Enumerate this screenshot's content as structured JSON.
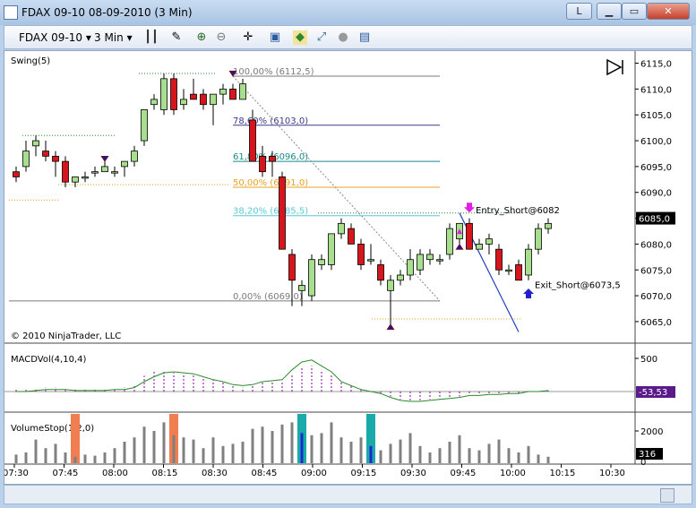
{
  "window": {
    "title": "FDAX 09-10  08-09-2010 (3 Min)",
    "lock_label": "L",
    "min_label": "▁",
    "max_label": "▭",
    "close_label": "✕"
  },
  "toolbar": {
    "instrument": "FDAX 09-10",
    "interval": "3 Min",
    "icons": [
      "bar-type-icon",
      "pencil-icon",
      "zoom-in-icon",
      "zoom-out-icon",
      "crosshair-icon",
      "data-box-icon",
      "strategy-icon",
      "chart-trader-icon",
      "properties-icon",
      "grid-icon"
    ]
  },
  "colors": {
    "up_candle": "#a8df8e",
    "down_candle": "#d6161c",
    "fib_base": "#7a7a7a",
    "fib_1": "#3a3a8a",
    "fib_2": "#1a8a8a",
    "fib_3": "#e8a020",
    "fib_4": "#5ac8d8",
    "entry_arrow": "#e020e0",
    "exit_arrow": "#2020d0",
    "macd_line": "#2a8a2a",
    "macd_hist": "#8a00a0",
    "volstop_orange": "#f07e50",
    "volstop_teal": "#1aaaaa",
    "volume_gray": "#808080"
  },
  "chart_data": {
    "type": "candlestick",
    "x_ticks": [
      "07:30",
      "07:45",
      "08:00",
      "08:15",
      "08:30",
      "08:45",
      "09:00",
      "09:15",
      "09:30",
      "09:45",
      "10:00",
      "10:15",
      "10:30"
    ],
    "candles": [
      {
        "o": 6094,
        "h": 6095,
        "l": 6092,
        "c": 6093
      },
      {
        "o": 6095,
        "h": 6100,
        "l": 6094,
        "c": 6098
      },
      {
        "o": 6099,
        "h": 6101,
        "l": 6097,
        "c": 6100
      },
      {
        "o": 6098,
        "h": 6100,
        "l": 6096,
        "c": 6097
      },
      {
        "o": 6097,
        "h": 6098,
        "l": 6093,
        "c": 6096
      },
      {
        "o": 6096,
        "h": 6097,
        "l": 6091,
        "c": 6092
      },
      {
        "o": 6092,
        "h": 6093,
        "l": 6091,
        "c": 6093
      },
      {
        "o": 6093,
        "h": 6094,
        "l": 6092,
        "c": 6093
      },
      {
        "o": 6094,
        "h": 6095,
        "l": 6093,
        "c": 6094
      },
      {
        "o": 6094,
        "h": 6096,
        "l": 6094,
        "c": 6095
      },
      {
        "o": 6094,
        "h": 6095,
        "l": 6093,
        "c": 6094
      },
      {
        "o": 6095,
        "h": 6096,
        "l": 6093,
        "c": 6096
      },
      {
        "o": 6096,
        "h": 6099,
        "l": 6095,
        "c": 6098
      },
      {
        "o": 6100,
        "h": 6106,
        "l": 6099,
        "c": 6106
      },
      {
        "o": 6107,
        "h": 6109,
        "l": 6106,
        "c": 6108
      },
      {
        "o": 6106,
        "h": 6113,
        "l": 6105,
        "c": 6112
      },
      {
        "o": 6112,
        "h": 6113,
        "l": 6105,
        "c": 6106
      },
      {
        "o": 6107,
        "h": 6110,
        "l": 6106,
        "c": 6108
      },
      {
        "o": 6109,
        "h": 6112,
        "l": 6108,
        "c": 6108
      },
      {
        "o": 6109,
        "h": 6110,
        "l": 6106,
        "c": 6107
      },
      {
        "o": 6107,
        "h": 6109,
        "l": 6103,
        "c": 6109
      },
      {
        "o": 6109,
        "h": 6111,
        "l": 6107,
        "c": 6110
      },
      {
        "o": 6110,
        "h": 6111,
        "l": 6108,
        "c": 6108
      },
      {
        "o": 6108,
        "h": 6112,
        "l": 6108,
        "c": 6111
      },
      {
        "o": 6104,
        "h": 6106,
        "l": 6096,
        "c": 6096
      },
      {
        "o": 6097,
        "h": 6099,
        "l": 6093,
        "c": 6094
      },
      {
        "o": 6097,
        "h": 6098,
        "l": 6093,
        "c": 6096
      },
      {
        "o": 6093,
        "h": 6094,
        "l": 6079,
        "c": 6079
      },
      {
        "o": 6078,
        "h": 6079,
        "l": 6068,
        "c": 6073
      },
      {
        "o": 6071,
        "h": 6073,
        "l": 6068,
        "c": 6072
      },
      {
        "o": 6070,
        "h": 6078,
        "l": 6069,
        "c": 6077
      },
      {
        "o": 6076,
        "h": 6078,
        "l": 6075,
        "c": 6077
      },
      {
        "o": 6076,
        "h": 6082,
        "l": 6075,
        "c": 6082
      },
      {
        "o": 6082,
        "h": 6085,
        "l": 6081,
        "c": 6084
      },
      {
        "o": 6083,
        "h": 6084,
        "l": 6080,
        "c": 6080
      },
      {
        "o": 6080,
        "h": 6081,
        "l": 6075,
        "c": 6076
      },
      {
        "o": 6077,
        "h": 6080,
        "l": 6076,
        "c": 6077
      },
      {
        "o": 6076,
        "h": 6077,
        "l": 6072,
        "c": 6073
      },
      {
        "o": 6071,
        "h": 6074,
        "l": 6064,
        "c": 6073
      },
      {
        "o": 6073,
        "h": 6075,
        "l": 6072,
        "c": 6074
      },
      {
        "o": 6074,
        "h": 6079,
        "l": 6073,
        "c": 6077
      },
      {
        "o": 6075,
        "h": 6079,
        "l": 6074,
        "c": 6078
      },
      {
        "o": 6077,
        "h": 6079,
        "l": 6076,
        "c": 6078
      },
      {
        "o": 6077,
        "h": 6078,
        "l": 6076,
        "c": 6077
      },
      {
        "o": 6078,
        "h": 6084,
        "l": 6077,
        "c": 6083
      },
      {
        "o": 6081,
        "h": 6084,
        "l": 6080,
        "c": 6084
      },
      {
        "o": 6084,
        "h": 6085,
        "l": 6079,
        "c": 6079
      },
      {
        "o": 6079,
        "h": 6081,
        "l": 6079,
        "c": 6080
      },
      {
        "o": 6080,
        "h": 6082,
        "l": 6078,
        "c": 6081
      },
      {
        "o": 6079,
        "h": 6080,
        "l": 6074,
        "c": 6075
      },
      {
        "o": 6075,
        "h": 6076,
        "l": 6074,
        "c": 6075
      },
      {
        "o": 6076,
        "h": 6077,
        "l": 6073,
        "c": 6073
      },
      {
        "o": 6074,
        "h": 6080,
        "l": 6073,
        "c": 6079
      },
      {
        "o": 6079,
        "h": 6084,
        "l": 6078,
        "c": 6083
      },
      {
        "o": 6083,
        "h": 6085,
        "l": 6082,
        "c": 6084
      }
    ],
    "price_axis": {
      "ylim": [
        6061,
        6117
      ],
      "ticks": [
        "6115,0",
        "6110,0",
        "6105,0",
        "6100,0",
        "6095,0",
        "6090,0",
        "6085,0",
        "6080,0",
        "6075,0",
        "6070,0",
        "6065,0"
      ],
      "current": "6085,0"
    },
    "panel1_label": "Swing(5)",
    "copyright": "© 2010 NinjaTrader, LLC",
    "fib_levels": [
      {
        "pct": "100,00%",
        "text": "100,00% (6112,5)",
        "value": 6112.5,
        "color": "#7a7a7a"
      },
      {
        "pct": "78,60%",
        "text": "78,60% (6103,0)",
        "value": 6103.0,
        "color": "#3a3a8a"
      },
      {
        "pct": "61,80%",
        "text": "61,80% (6096,0)",
        "value": 6096.0,
        "color": "#1a8a8a"
      },
      {
        "pct": "50,00%",
        "text": "50,00% (6091,0)",
        "value": 6091.0,
        "color": "#e8a020"
      },
      {
        "pct": "38,20%",
        "text": "38,20% (6085,5)",
        "value": 6085.5,
        "color": "#5ac8d8"
      },
      {
        "pct": "0,00%",
        "text": "0,00% (6069,0)",
        "value": 6069.0,
        "color": "#7a7a7a"
      }
    ],
    "entry_label": "Entry_Short@6082",
    "exit_label": "Exit_Short@6073,5",
    "macd": {
      "label": "MACDVol(4,10,4)",
      "ticks": [
        "500"
      ],
      "current": "-53,53",
      "hist": [
        0.1,
        0.1,
        0.1,
        0.2,
        0.2,
        0.15,
        0.1,
        0.1,
        0.1,
        0.15,
        0.15,
        0.2,
        0.3,
        0.8,
        1.0,
        1.0,
        0.95,
        0.9,
        0.85,
        0.75,
        0.6,
        0.5,
        0.35,
        0.2,
        0.35,
        0.45,
        0.55,
        0.55,
        0.9,
        1.2,
        1.3,
        1.1,
        0.9,
        0.55,
        0.3,
        0.1,
        0.0,
        -0.1,
        -0.25,
        -0.4,
        -0.45,
        -0.45,
        -0.4,
        -0.4,
        -0.35,
        -0.25,
        -0.2,
        -0.2,
        -0.15,
        -0.15,
        -0.1,
        -0.1,
        0.0,
        0.0,
        0.05
      ],
      "line": [
        0.0,
        0.0,
        0.05,
        0.1,
        0.1,
        0.1,
        0.05,
        0.05,
        0.05,
        0.05,
        0.1,
        0.1,
        0.2,
        0.5,
        0.75,
        0.95,
        1.0,
        0.95,
        0.9,
        0.75,
        0.6,
        0.5,
        0.35,
        0.3,
        0.35,
        0.5,
        0.55,
        0.6,
        1.1,
        1.5,
        1.6,
        1.3,
        1.0,
        0.5,
        0.3,
        0.1,
        0.0,
        -0.1,
        -0.3,
        -0.45,
        -0.5,
        -0.5,
        -0.45,
        -0.4,
        -0.35,
        -0.3,
        -0.2,
        -0.2,
        -0.15,
        -0.15,
        -0.1,
        -0.1,
        0.0,
        0.0,
        0.05
      ]
    },
    "volume_stop": {
      "label": "VolumeStop(1,2,0)",
      "ticks": [
        "2000",
        "0"
      ],
      "current": "316",
      "volume": [
        400,
        500,
        1100,
        700,
        900,
        500,
        300,
        400,
        350,
        500,
        700,
        1000,
        1200,
        1700,
        1500,
        1900,
        1300,
        1200,
        1100,
        700,
        1200,
        800,
        900,
        1000,
        1600,
        1700,
        1500,
        1800,
        1900,
        1400,
        1300,
        1400,
        1900,
        1200,
        1000,
        1200,
        800,
        600,
        900,
        1100,
        1400,
        800,
        500,
        700,
        1000,
        1300,
        700,
        600,
        900,
        1100,
        700,
        500,
        800,
        400,
        300
      ],
      "stop_bars": [
        {
          "index": 6,
          "color": "#f07e50"
        },
        {
          "index": 16,
          "color": "#f07e50"
        },
        {
          "index": 29,
          "color": "#1aaaaa"
        },
        {
          "index": 36,
          "color": "#1aaaaa"
        }
      ]
    }
  }
}
